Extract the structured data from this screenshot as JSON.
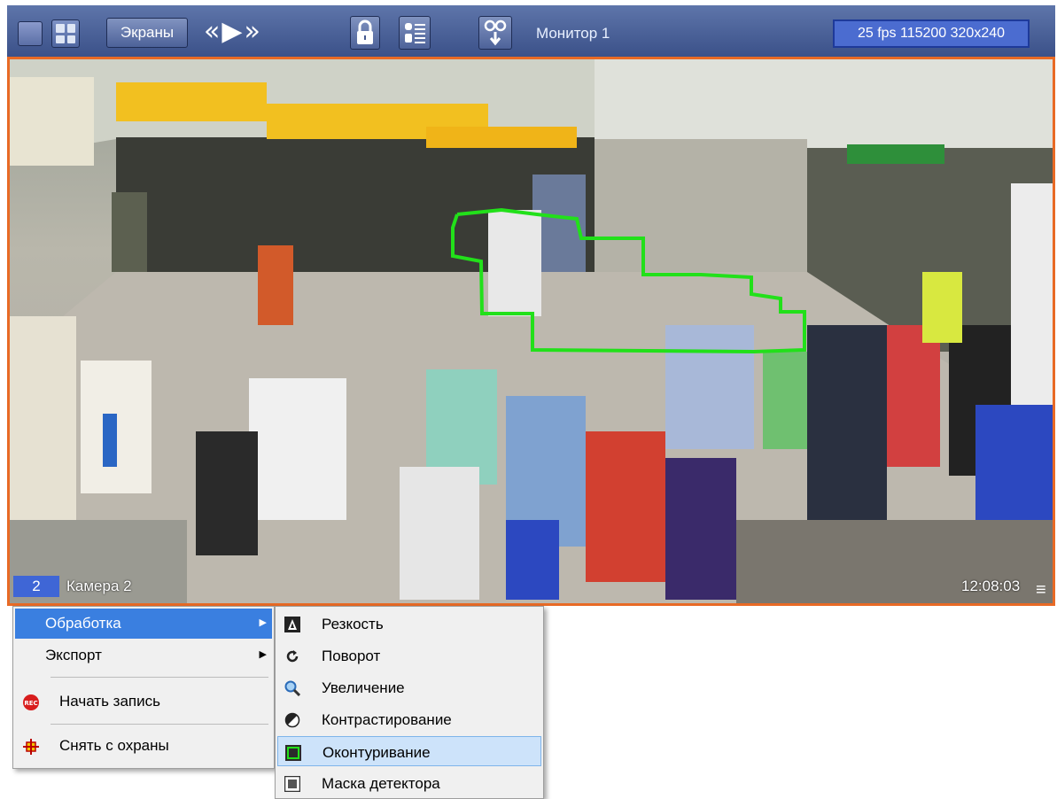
{
  "toolbar": {
    "screens_label": "Экраны",
    "monitor_label": "Монитор 1",
    "stream_info": "25 fps 115200 320x240"
  },
  "camera": {
    "number": "2",
    "name": "Камера 2",
    "time": "12:08:03"
  },
  "context_menu": {
    "items": [
      {
        "label": "Обработка",
        "has_submenu": true,
        "active": true
      },
      {
        "label": "Экспорт",
        "has_submenu": true
      },
      {
        "label": "Начать запись",
        "icon": "record-icon"
      },
      {
        "label": "Снять с охраны",
        "icon": "disarm-icon"
      }
    ]
  },
  "processing_submenu": {
    "items": [
      {
        "label": "Резкость",
        "icon": "sharpness-icon"
      },
      {
        "label": "Поворот",
        "icon": "rotate-icon"
      },
      {
        "label": "Увеличение",
        "icon": "zoom-icon"
      },
      {
        "label": "Контрастирование",
        "icon": "contrast-icon"
      },
      {
        "label": "Оконтуривание",
        "icon": "contour-icon",
        "highlighted": true
      },
      {
        "label": "Маска детектора",
        "icon": "detector-mask-icon"
      }
    ]
  },
  "colors": {
    "toolbar_bg": "#4a5f95",
    "video_border": "#e86a25",
    "contour": "#22e01a",
    "menu_active": "#3a7fe0",
    "submenu_highlight": "#cde3fa"
  }
}
